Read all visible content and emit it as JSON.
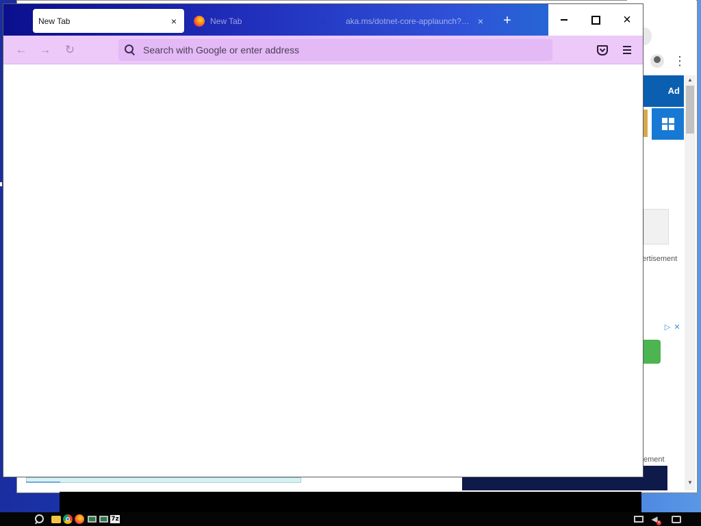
{
  "browser": {
    "tabs": [
      {
        "label": "New Tab",
        "active": true
      },
      {
        "label": "New Tab",
        "active": false
      },
      {
        "label": "aka.ms/dotnet-core-applaunch?missing",
        "active": false
      }
    ],
    "new_tab_symbol": "+",
    "close_symbol": "×",
    "window_controls": {
      "minimize": "minimize",
      "maximize": "maximize",
      "close": "×"
    },
    "nav": {
      "back": "←",
      "forward": "→",
      "reload": "↻"
    },
    "urlbar": {
      "placeholder": "Search with Google or enter address",
      "value": ""
    },
    "toolbar_icons": [
      "pocket-icon",
      "hamburger-menu-icon"
    ],
    "colors": {
      "tabbar_start": "#0a0f8c",
      "tabbar_end": "#1e7ad4",
      "navbar": "#ecc9f8",
      "urlbar": "#e3b9f6"
    }
  },
  "background_window": {
    "ad_header": "Ad",
    "ad_label_1": "ertisement",
    "ad_label_2": "ement",
    "ad_choices": [
      "▷",
      "✕"
    ],
    "menu_symbol": "⋮"
  },
  "taskbar": {
    "icons": [
      "search-icon",
      "file-explorer-icon",
      "chrome-icon",
      "firefox-icon",
      "monitor-icon",
      "7zip-icon",
      "network-icon",
      "volume-muted-icon",
      "notification-icon"
    ],
    "sevenzip_label": "7z"
  }
}
